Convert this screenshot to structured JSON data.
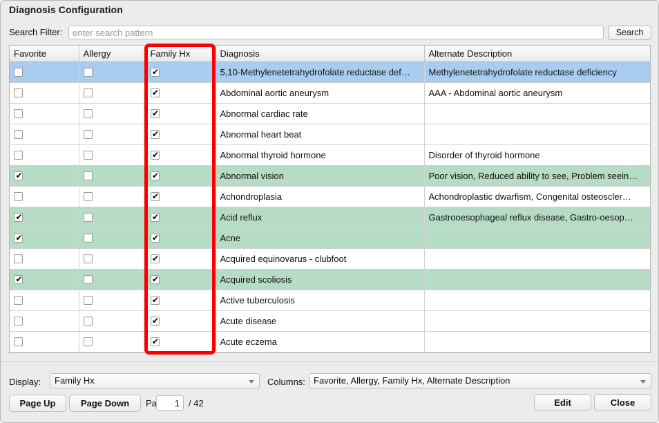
{
  "window": {
    "title": "Diagnosis Configuration"
  },
  "search": {
    "label": "Search Filter:",
    "value": "",
    "placeholder": "enter search pattern",
    "button_label": "Search"
  },
  "table": {
    "columns": [
      "Favorite",
      "Allergy",
      "Family Hx",
      "Diagnosis",
      "Alternate Description"
    ],
    "rows": [
      {
        "favorite": false,
        "allergy": false,
        "family_hx": true,
        "diagnosis": "5,10-Methylenetetrahydrofolate reductase def…",
        "alternate_description": "Methylenetetrahydrofolate reductase deficiency",
        "state": "selected"
      },
      {
        "favorite": false,
        "allergy": false,
        "family_hx": true,
        "diagnosis": "Abdominal aortic aneurysm",
        "alternate_description": "AAA - Abdominal aortic aneurysm",
        "state": "plain"
      },
      {
        "favorite": false,
        "allergy": false,
        "family_hx": true,
        "diagnosis": "Abnormal cardiac rate",
        "alternate_description": "",
        "state": "plain"
      },
      {
        "favorite": false,
        "allergy": false,
        "family_hx": true,
        "diagnosis": "Abnormal heart beat",
        "alternate_description": "",
        "state": "plain"
      },
      {
        "favorite": false,
        "allergy": false,
        "family_hx": true,
        "diagnosis": "Abnormal thyroid hormone",
        "alternate_description": "Disorder of thyroid hormone",
        "state": "plain"
      },
      {
        "favorite": true,
        "allergy": false,
        "family_hx": true,
        "diagnosis": "Abnormal vision",
        "alternate_description": "Poor vision, Reduced ability to see, Problem seein…",
        "state": "favorite"
      },
      {
        "favorite": false,
        "allergy": false,
        "family_hx": true,
        "diagnosis": "Achondroplasia",
        "alternate_description": "Achondroplastic dwarfism, Congenital osteoscler…",
        "state": "plain"
      },
      {
        "favorite": true,
        "allergy": false,
        "family_hx": true,
        "diagnosis": "Acid reflux",
        "alternate_description": "Gastrooesophageal reflux disease, Gastro-oesop…",
        "state": "favorite"
      },
      {
        "favorite": true,
        "allergy": false,
        "family_hx": true,
        "diagnosis": "Acne",
        "alternate_description": "",
        "state": "favorite"
      },
      {
        "favorite": false,
        "allergy": false,
        "family_hx": true,
        "diagnosis": "Acquired equinovarus - clubfoot",
        "alternate_description": "",
        "state": "plain"
      },
      {
        "favorite": true,
        "allergy": false,
        "family_hx": true,
        "diagnosis": "Acquired scoliosis",
        "alternate_description": "",
        "state": "favorite"
      },
      {
        "favorite": false,
        "allergy": false,
        "family_hx": true,
        "diagnosis": "Active tuberculosis",
        "alternate_description": "",
        "state": "plain"
      },
      {
        "favorite": false,
        "allergy": false,
        "family_hx": true,
        "diagnosis": "Acute disease",
        "alternate_description": "",
        "state": "plain"
      },
      {
        "favorite": false,
        "allergy": false,
        "family_hx": true,
        "diagnosis": "Acute eczema",
        "alternate_description": "",
        "state": "plain"
      }
    ]
  },
  "annotation": {
    "highlight_color": "#fb0000",
    "highlighted_column": "Family Hx"
  },
  "footer": {
    "display_label": "Display:",
    "display_value": "Family Hx",
    "columns_label": "Columns:",
    "columns_value": "Favorite, Allergy, Family Hx, Alternate Description",
    "page_up_label": "Page Up",
    "page_down_label": "Page Down",
    "page_label": "Page",
    "page_value": "1",
    "page_total": "/ 42",
    "edit_label": "Edit",
    "close_label": "Close"
  },
  "colors": {
    "selected_row": "#a8cdf0",
    "favorite_row": "#b7dcc5",
    "panel": "#ececec"
  }
}
